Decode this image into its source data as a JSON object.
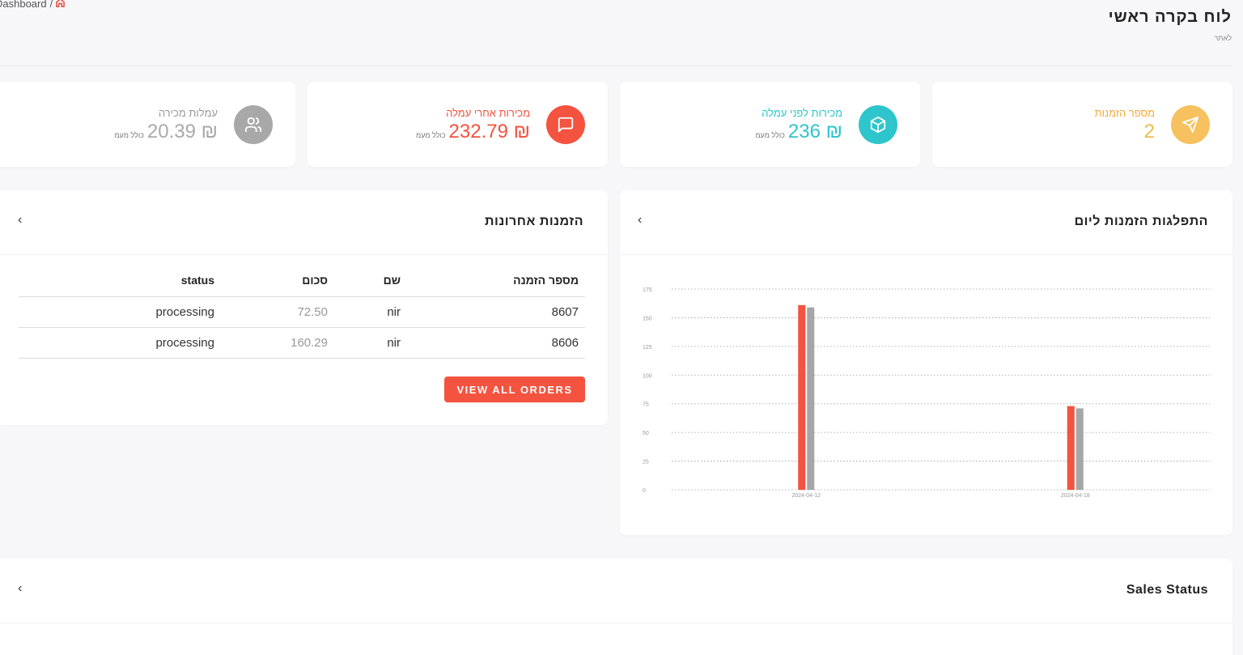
{
  "breadcrumb": {
    "root": "Dashboard",
    "separator": "/",
    "home_icon": "home-icon"
  },
  "page": {
    "title": "לוח בקרה ראשי",
    "subtitle": "לאתר"
  },
  "stats": [
    {
      "id": "orders",
      "label": "מספר הזמנות",
      "value": "2",
      "note": "",
      "color": "#f6b94f",
      "label_color": "#f2a93b",
      "icon": "send-icon"
    },
    {
      "id": "before_fee",
      "label": "מכירות לפני עמלה",
      "value": "₪ 236",
      "note": "כולל מעמ",
      "color": "#2ec5cc",
      "label_color": "#2ec5cc",
      "icon": "box-icon"
    },
    {
      "id": "after_fee",
      "label": "מכירות אחרי עמלה",
      "value": "₪ 232.79",
      "note": "כולל מעמ",
      "color": "#f4533f",
      "label_color": "#f4533f",
      "icon": "message-icon"
    },
    {
      "id": "fees",
      "label": "עמלות מכירה",
      "value": "₪ 20.39",
      "note": "כולל מעמ",
      "color": "#aaaaaa",
      "label_color": "#999999",
      "icon": "users-icon"
    }
  ],
  "chart_panel": {
    "title": "התפלגות הזמנות ליום",
    "chevron": "‹"
  },
  "chart_data": {
    "type": "bar",
    "categories": [
      "2024-04-12",
      "2024-04-18"
    ],
    "series": [
      {
        "values": [
          161,
          73
        ],
        "color": "#f4533f"
      },
      {
        "values": [
          159,
          71
        ],
        "color": "#a6a6a6"
      }
    ],
    "ylim": [
      0,
      175
    ],
    "yticks": [
      0,
      25,
      50,
      75,
      100,
      125,
      150,
      175
    ],
    "grid": true
  },
  "orders_panel": {
    "title": "הזמנות אחרונות",
    "chevron": "‹",
    "columns": [
      "מספר הזמנה",
      "שם",
      "סכום",
      "status"
    ],
    "rows": [
      {
        "order": "8607",
        "name": "nir",
        "amount": "72.50",
        "status": "processing"
      },
      {
        "order": "8606",
        "name": "nir",
        "amount": "160.29",
        "status": "processing"
      }
    ],
    "button": "VIEW ALL ORDERS"
  },
  "sales_panel": {
    "title": "Sales Status",
    "chevron": "‹"
  }
}
